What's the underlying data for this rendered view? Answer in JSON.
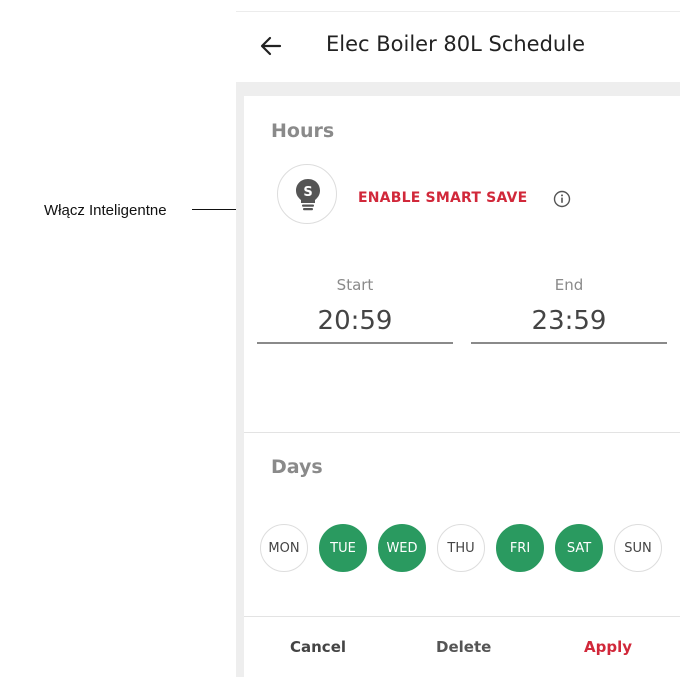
{
  "callout": {
    "label": "Włącz Inteligentne"
  },
  "header": {
    "title": "Elec Boiler 80L Schedule",
    "back_icon": "arrow-left-icon"
  },
  "hours": {
    "title": "Hours",
    "smart_save_icon": "lightbulb-s-icon",
    "smart_save_label": "ENABLE SMART SAVE",
    "info_icon": "info-circle-icon",
    "start_label": "Start",
    "start_value": "20:59",
    "end_label": "End",
    "end_value": "23:59"
  },
  "days": {
    "title": "Days",
    "items": [
      {
        "label": "MON",
        "selected": false
      },
      {
        "label": "TUE",
        "selected": true
      },
      {
        "label": "WED",
        "selected": true
      },
      {
        "label": "THU",
        "selected": false
      },
      {
        "label": "FRI",
        "selected": true
      },
      {
        "label": "SAT",
        "selected": true
      },
      {
        "label": "SUN",
        "selected": false
      }
    ]
  },
  "actions": {
    "cancel": "Cancel",
    "delete": "Delete",
    "apply": "Apply"
  },
  "colors": {
    "accent_red": "#d1283a",
    "selected_green": "#2a9a60"
  }
}
